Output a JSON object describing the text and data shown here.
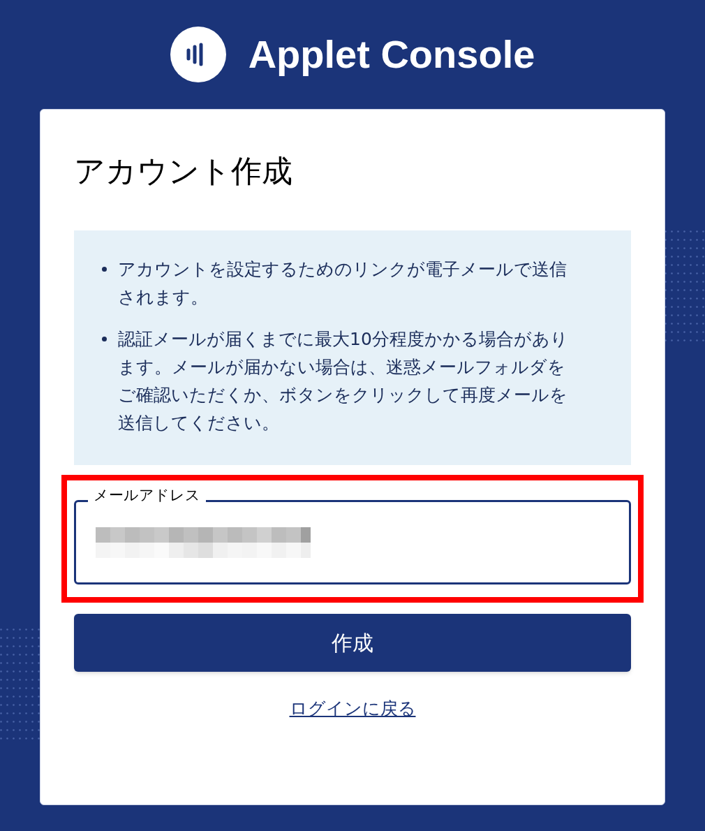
{
  "header": {
    "title": "Applet Console"
  },
  "card": {
    "title": "アカウント作成",
    "notes": [
      "アカウントを設定するためのリンクが電子メールで送信されます。",
      "認証メールが届くまでに最大10分程度かかる場合があります。メールが届かない場合は、迷惑メールフォルダをご確認いただくか、ボタンをクリックして再度メールを送信してください。"
    ],
    "email_field": {
      "label": "メールアドレス",
      "highlighted": true
    },
    "submit_button": "作成",
    "back_link": "ログインに戻る"
  }
}
